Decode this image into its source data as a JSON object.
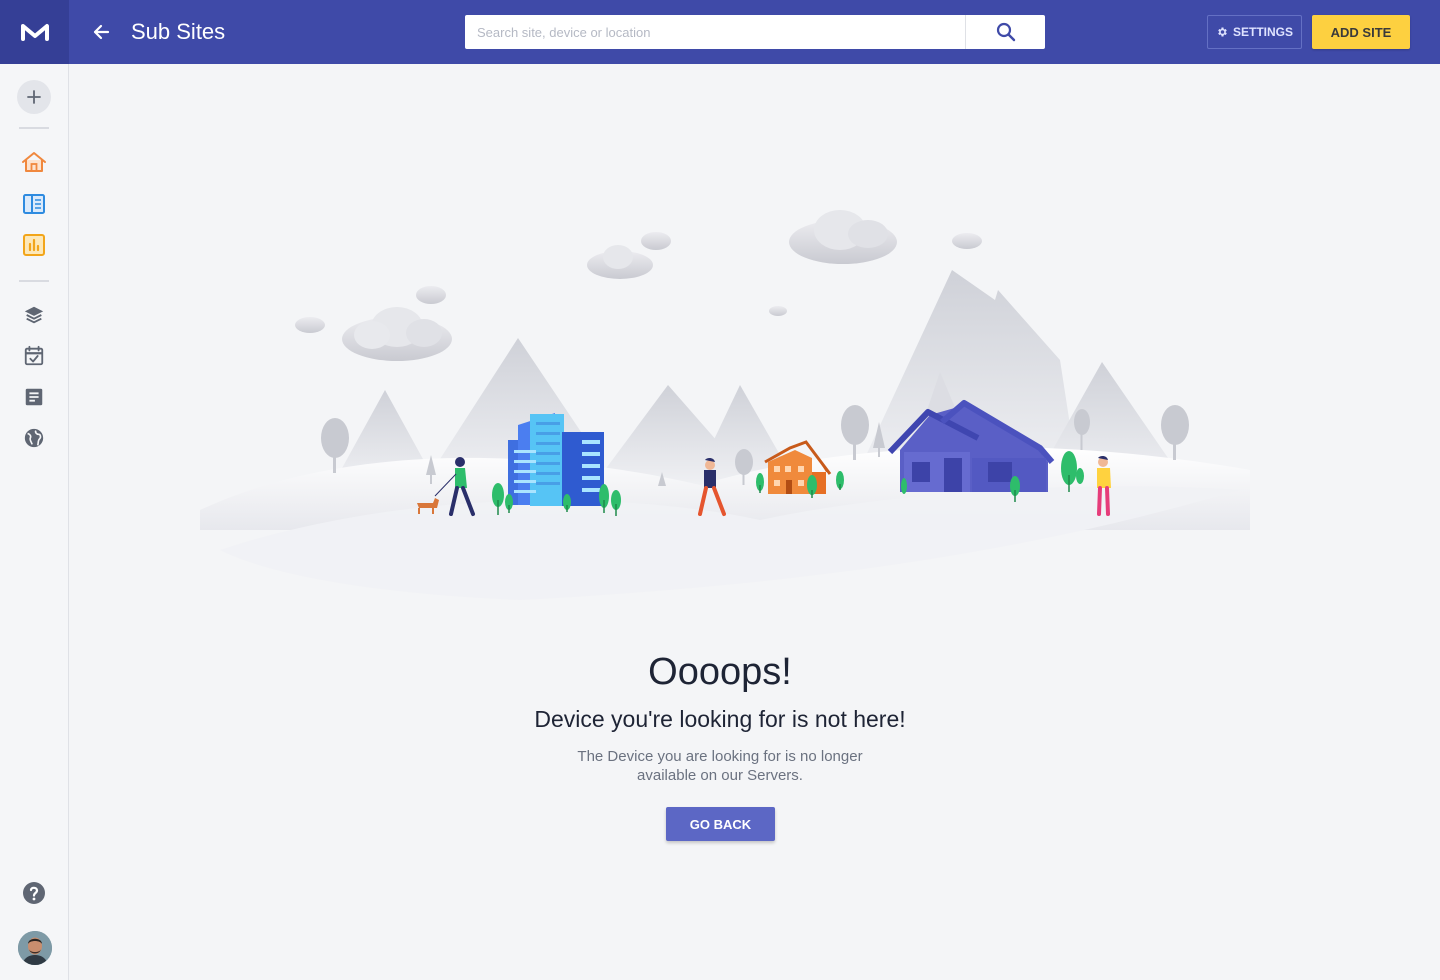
{
  "header": {
    "title": "Sub Sites",
    "search_placeholder": "Search site, device or location",
    "settings_label": "SETTINGS",
    "add_site_label": "ADD SITE"
  },
  "sidebar": {
    "items": [
      {
        "name": "home",
        "icon": "home-icon",
        "color": "#f0883e"
      },
      {
        "name": "devices",
        "icon": "columns-icon",
        "color": "#2e8be0"
      },
      {
        "name": "reports",
        "icon": "bar-chart-icon",
        "color": "#f2a51a"
      },
      {
        "name": "layers",
        "icon": "layers-icon",
        "color": "#5f6673"
      },
      {
        "name": "calendar",
        "icon": "calendar-check-icon",
        "color": "#5f6673"
      },
      {
        "name": "documents",
        "icon": "document-icon",
        "color": "#5f6673"
      },
      {
        "name": "globe",
        "icon": "globe-icon",
        "color": "#5f6673"
      }
    ],
    "help_icon": "help-icon"
  },
  "error": {
    "heading": "Oooops!",
    "subheading": "Device you're looking for is not here!",
    "description": "The Device you are looking for is no longer available on our Servers.",
    "button_label": "GO BACK"
  },
  "colors": {
    "header_bg": "#3f4aa8",
    "accent": "#fdd040",
    "button": "#5c67c5"
  }
}
